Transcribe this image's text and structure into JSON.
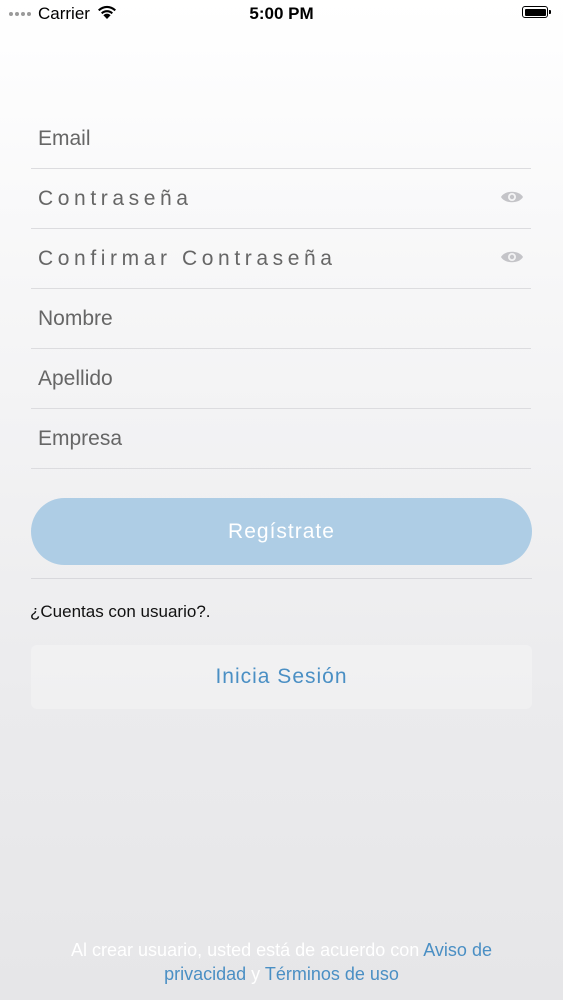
{
  "status_bar": {
    "carrier": "Carrier",
    "time": "5:00 PM"
  },
  "form": {
    "fields": [
      {
        "label": "Email",
        "has_eye": false
      },
      {
        "label": "Contraseña",
        "has_eye": true,
        "icon": "eye-icon"
      },
      {
        "label": "Confirmar Contraseña",
        "has_eye": true,
        "icon": "eye-icon"
      },
      {
        "label": "Nombre",
        "has_eye": false
      },
      {
        "label": "Apellido",
        "has_eye": false
      },
      {
        "label": "Empresa",
        "has_eye": false
      }
    ],
    "register_label": "Regístrate"
  },
  "login": {
    "question": "¿Cuentas con usuario?.",
    "button_label": "Inicia Sesión"
  },
  "terms": {
    "prefix": "Al crear usuario, usted está de acuerdo con ",
    "privacy_link": "Aviso de privacidad",
    "connector": " y ",
    "terms_link": "Términos de uso"
  },
  "colors": {
    "accent": "#4a8fc4",
    "register_button": "#aecde5",
    "divider": "#dcdcdf"
  }
}
